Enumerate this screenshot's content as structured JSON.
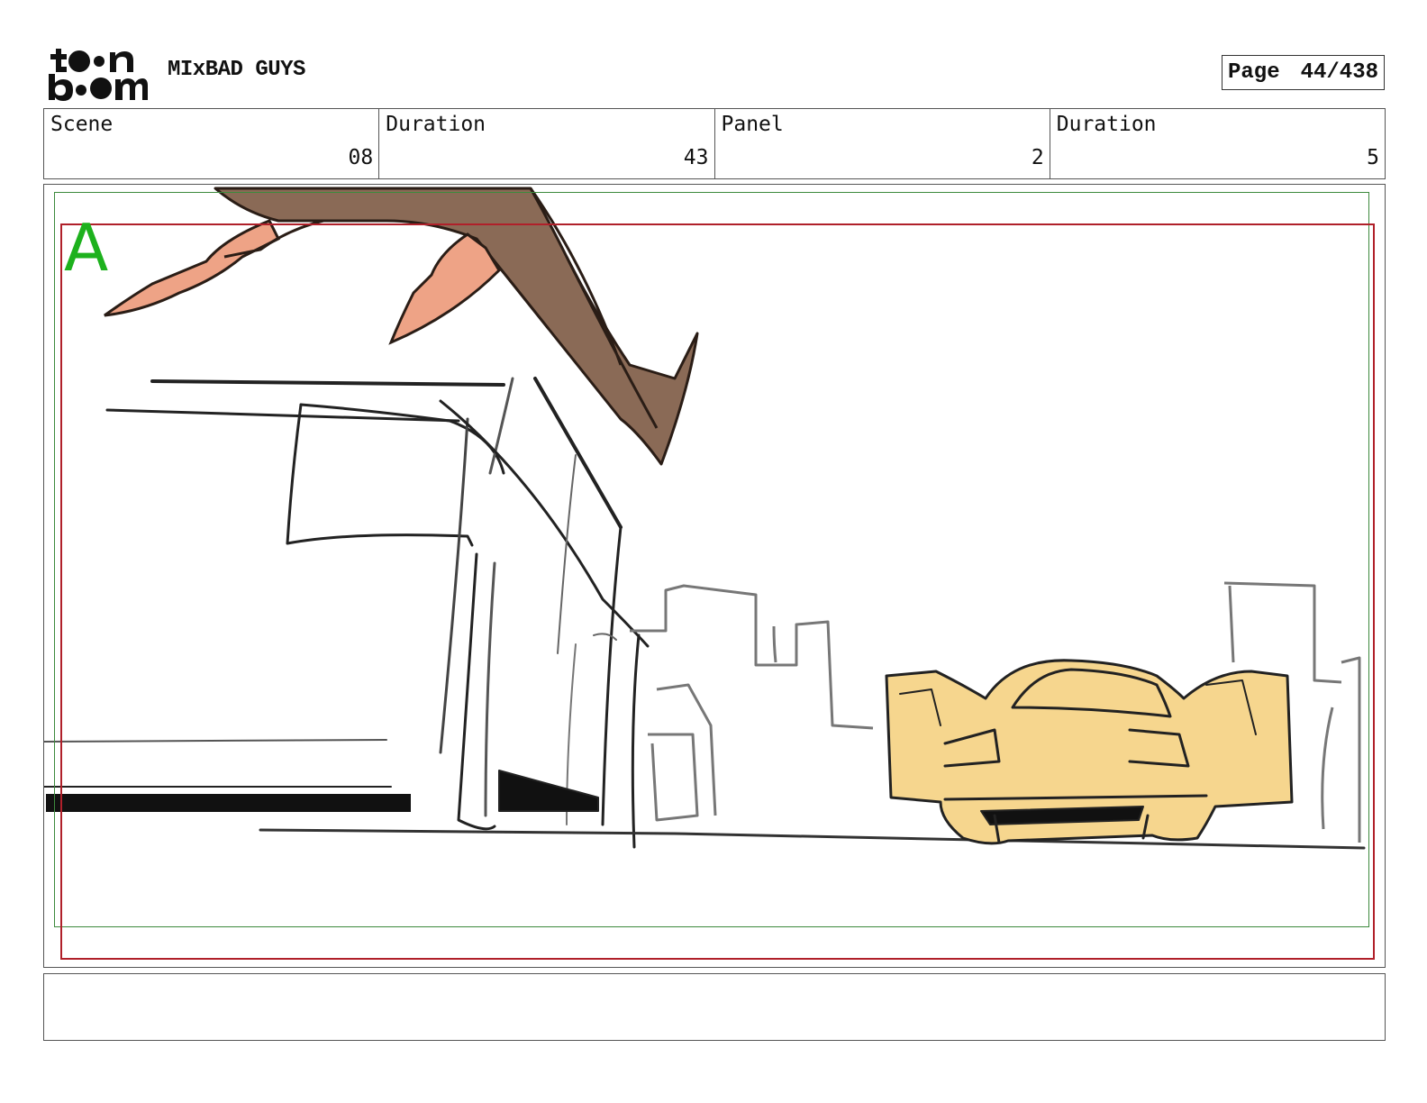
{
  "header": {
    "logo_alt": "toon boom",
    "project_title": "MIxBAD GUYS",
    "page_label": "Page",
    "page_number": "44/438"
  },
  "info": [
    {
      "label": "Scene",
      "value": "08"
    },
    {
      "label": "Duration",
      "value": "43"
    },
    {
      "label": "Panel",
      "value": "2"
    },
    {
      "label": "Duration",
      "value": "5"
    }
  ],
  "panel": {
    "layer_letter": "A",
    "dialogue": ""
  },
  "colors": {
    "safe_frame": "#3d8a3d",
    "action_frame": "#b0202a",
    "layer_letter": "#1db11d",
    "car_fill": "#f6d68e",
    "creature_fill": "#8a6a56",
    "hand_fill": "#eea386"
  },
  "icons": [
    "toon-boom-logo-icon"
  ]
}
